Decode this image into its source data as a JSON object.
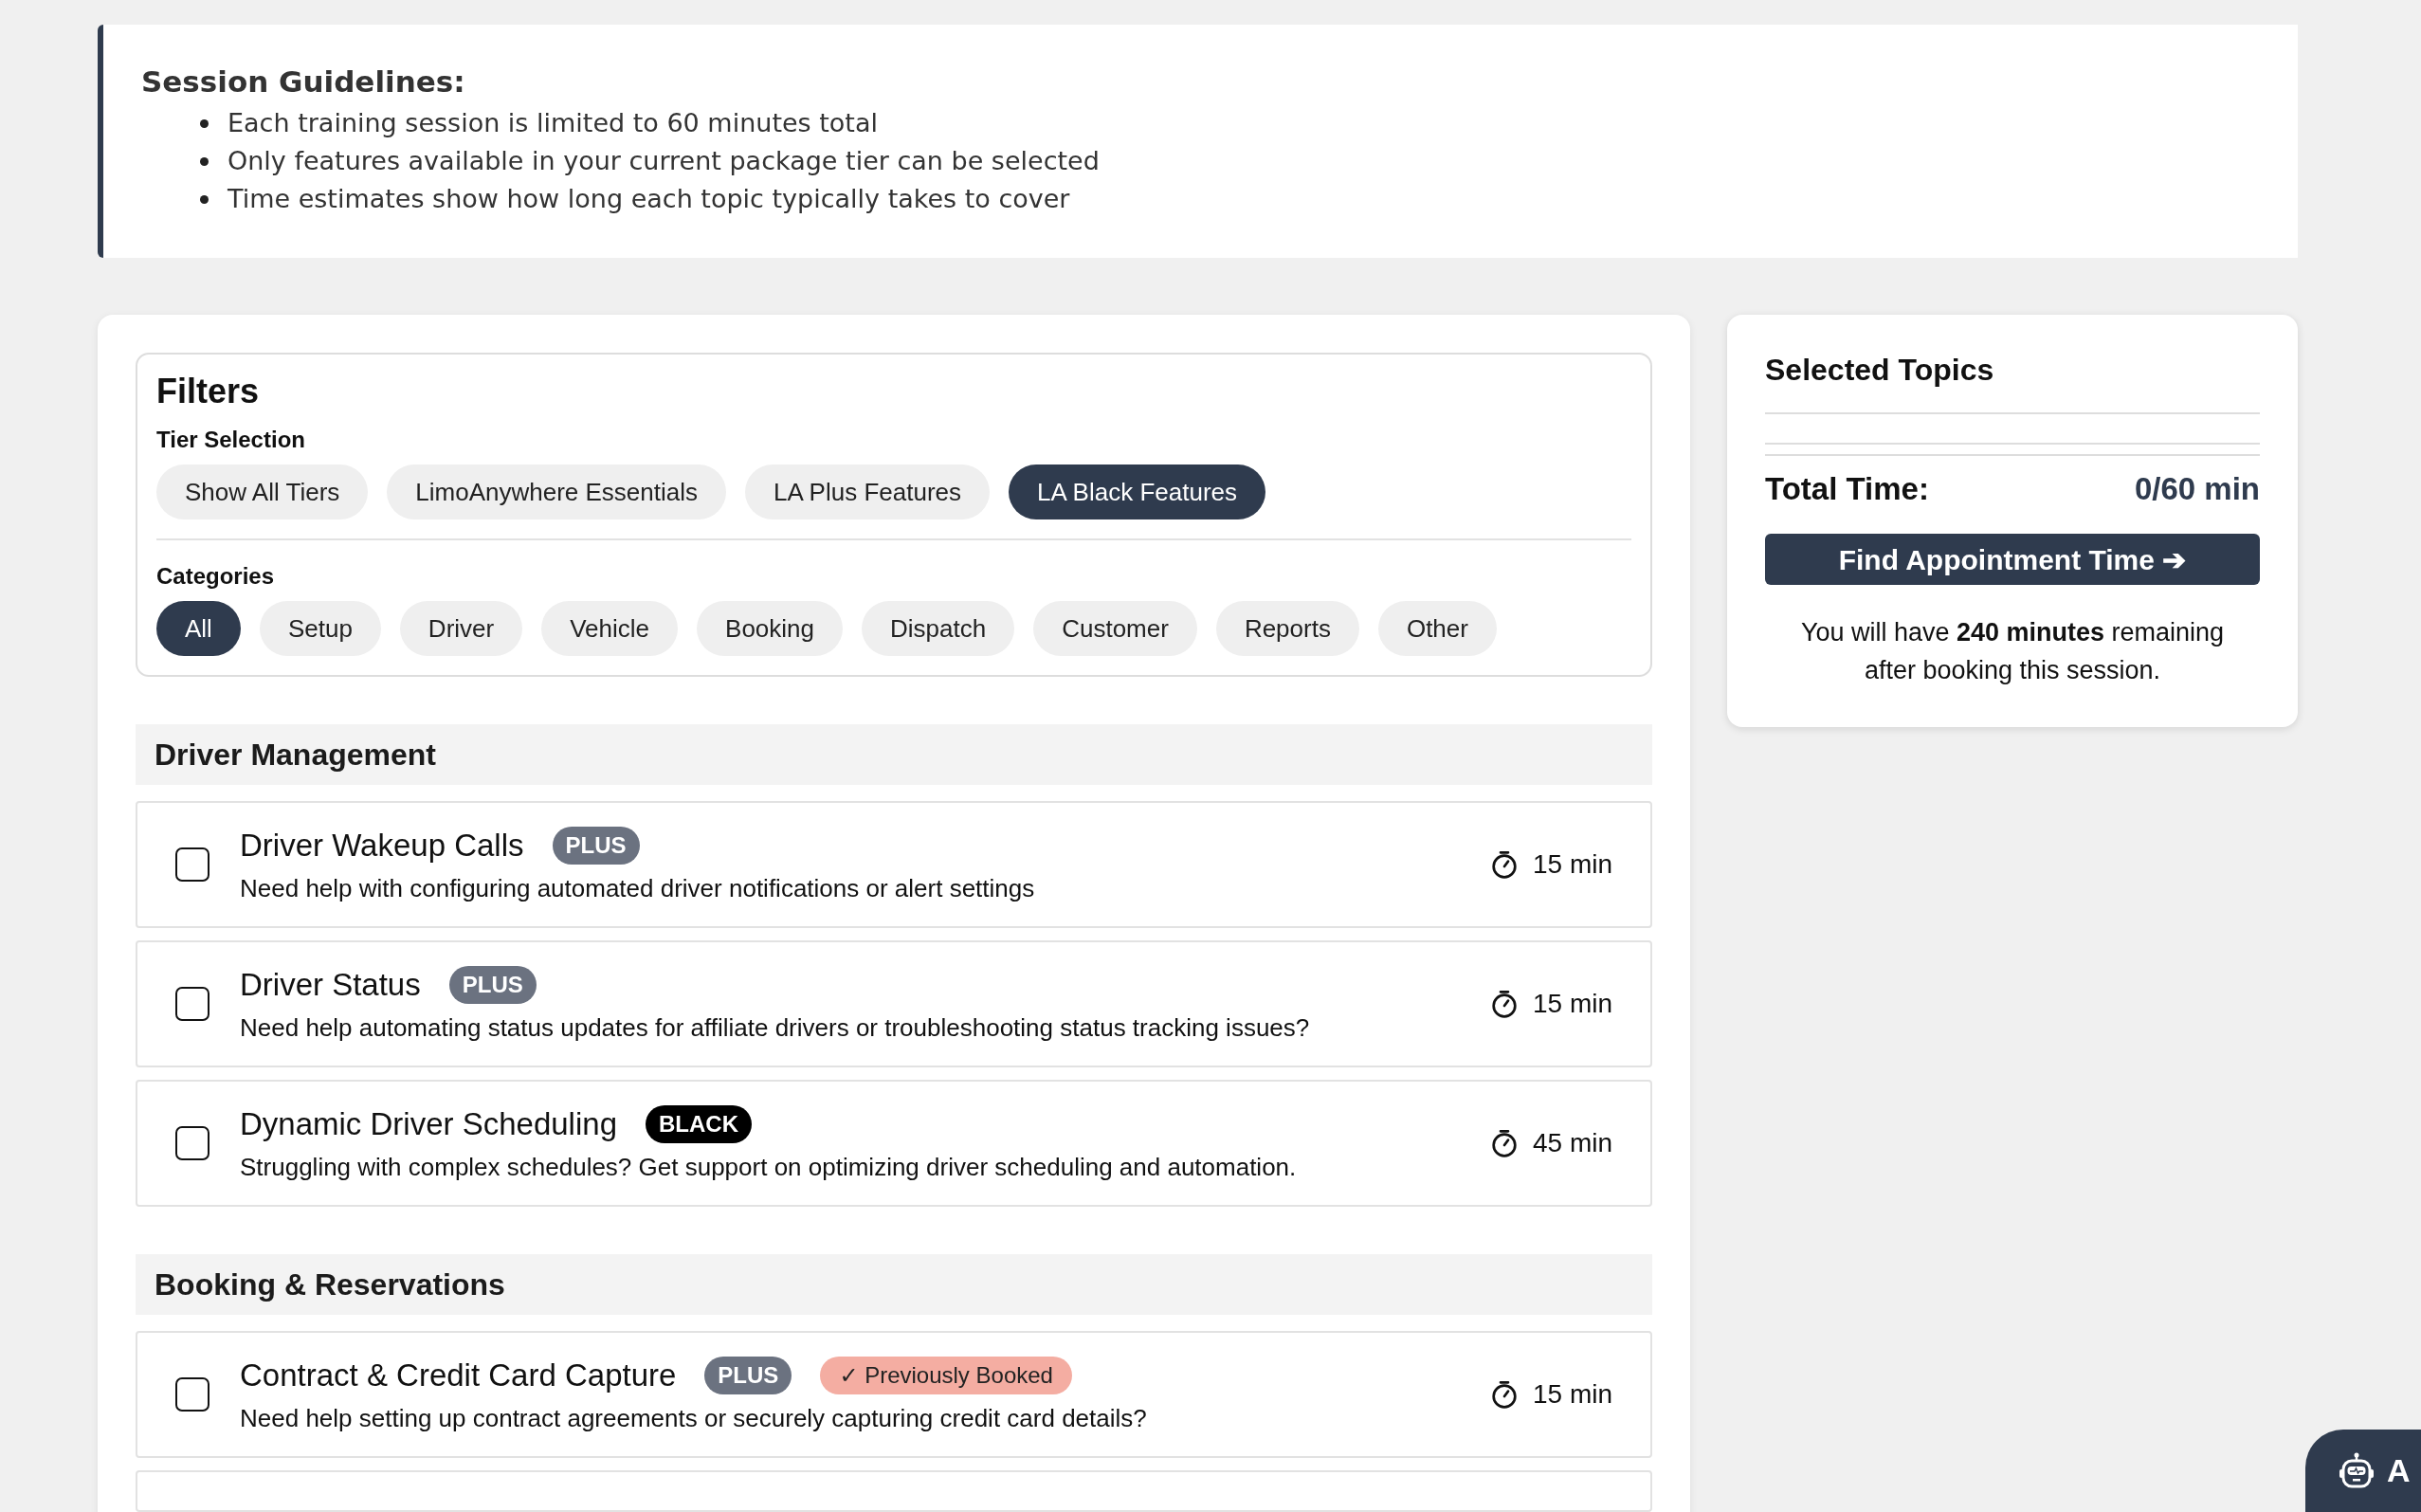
{
  "guidelines": {
    "title": "Session Guidelines:",
    "items": [
      "Each training session is limited to 60 minutes total",
      "Only features available in your current package tier can be selected",
      "Time estimates show how long each topic typically takes to cover"
    ]
  },
  "filters": {
    "title": "Filters",
    "tier_label": "Tier Selection",
    "tiers": [
      {
        "label": "Show All Tiers",
        "selected": false
      },
      {
        "label": "LimoAnywhere Essentials",
        "selected": false
      },
      {
        "label": "LA Plus Features",
        "selected": false
      },
      {
        "label": "LA Black Features",
        "selected": true
      }
    ],
    "categories_label": "Categories",
    "categories": [
      {
        "label": "All",
        "selected": true
      },
      {
        "label": "Setup",
        "selected": false
      },
      {
        "label": "Driver",
        "selected": false
      },
      {
        "label": "Vehicle",
        "selected": false
      },
      {
        "label": "Booking",
        "selected": false
      },
      {
        "label": "Dispatch",
        "selected": false
      },
      {
        "label": "Customer",
        "selected": false
      },
      {
        "label": "Reports",
        "selected": false
      },
      {
        "label": "Other",
        "selected": false
      }
    ]
  },
  "sections": [
    {
      "title": "Driver Management",
      "topics": [
        {
          "title": "Driver Wakeup Calls",
          "checked": false,
          "badges": [
            {
              "kind": "plus",
              "label": "PLUS"
            }
          ],
          "description": "Need help with configuring automated driver notifications or alert settings",
          "time": "15 min"
        },
        {
          "title": "Driver Status",
          "checked": false,
          "badges": [
            {
              "kind": "plus",
              "label": "PLUS"
            }
          ],
          "description": "Need help automating status updates for affiliate drivers or troubleshooting status tracking issues?",
          "time": "15 min"
        },
        {
          "title": "Dynamic Driver Scheduling",
          "checked": false,
          "badges": [
            {
              "kind": "black",
              "label": "BLACK"
            }
          ],
          "description": "Struggling with complex schedules? Get support on optimizing driver scheduling and automation.",
          "time": "45 min"
        }
      ]
    },
    {
      "title": "Booking & Reservations",
      "topics": [
        {
          "title": "Contract & Credit Card Capture",
          "checked": false,
          "badges": [
            {
              "kind": "plus",
              "label": "PLUS"
            },
            {
              "kind": "booked",
              "label": "✓ Previously Booked"
            }
          ],
          "description": "Need help setting up contract agreements or securely capturing credit card details?",
          "time": "15 min"
        }
      ]
    }
  ],
  "summary": {
    "title": "Selected Topics",
    "total_label": "Total Time:",
    "total_value": "0/60 min",
    "button": "Find Appointment Time ➔",
    "note": "You will have **240 minutes** remaining after booking this session."
  },
  "assistant_button": {
    "label": "A"
  }
}
